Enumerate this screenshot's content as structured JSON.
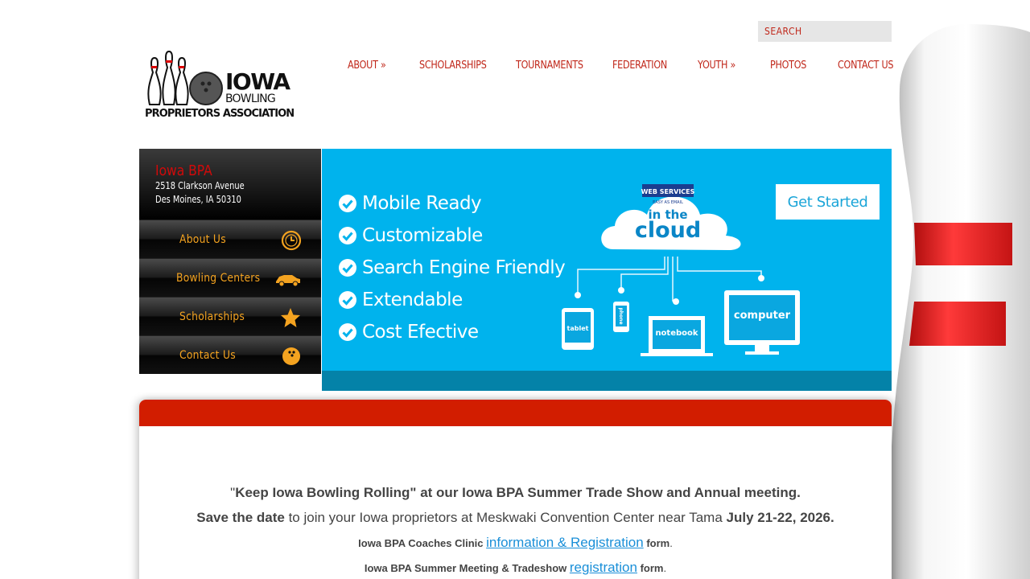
{
  "search": {
    "placeholder": "SEARCH"
  },
  "logo": {
    "line1": "IOWA",
    "line2": "BOWLING",
    "line3": "PROPRIETORS ASSOCIATION"
  },
  "nav": [
    {
      "label": "ABOUT »"
    },
    {
      "label": "SCHOLARSHIPS"
    },
    {
      "label": "TOURNAMENTS"
    },
    {
      "label": "FEDERATION"
    },
    {
      "label": "YOUTH »"
    },
    {
      "label": "PHOTOS"
    },
    {
      "label": "CONTACT US"
    }
  ],
  "sidebar": {
    "org_name": "Iowa BPA",
    "address1": "2518 Clarkson Avenue",
    "address2": "Des Moines, IA 50310",
    "items": [
      {
        "label": "About Us",
        "icon": "clock-icon"
      },
      {
        "label": "Bowling Centers",
        "icon": "car-icon"
      },
      {
        "label": "Scholarships",
        "icon": "star-icon"
      },
      {
        "label": "Contact Us",
        "icon": "bowling-ball-icon"
      }
    ]
  },
  "banner": {
    "features": [
      "Mobile Ready",
      "Customizable",
      "Search Engine Friendly",
      "Extendable",
      "Cost Efective"
    ],
    "cta": "Get Started",
    "cloud_badge": "WEB SERVICES",
    "cloud_badge_sub": "EASY AS EMAIL",
    "cloud_line1": "in the",
    "cloud_line2": "cloud",
    "devices": [
      "tablet",
      "phone",
      "notebook",
      "computer"
    ]
  },
  "content": {
    "l1_quote_open": "\"",
    "l1_bold": "Keep Iowa Bowling Rolling\" at our Iowa BPA Summer Trade Show and Annual meeting.",
    "l2_bold": "Save the date",
    "l2_mid": " to join your Iowa proprietors at Meskwaki Convention Center near Tama ",
    "l2_date": "July 21-22, 2026.",
    "l3_prefix": "Iowa BPA Coaches Clinic ",
    "l3_link": "information & Registration",
    "l3_suffix": " form",
    "l3_dot": ".",
    "l4_prefix": "Iowa BPA Summer Meeting & Tradeshow ",
    "l4_link": "registration",
    "l4_suffix": " form",
    "l4_dot": "."
  },
  "colors": {
    "nav_red": "#c0271a",
    "sidebar_gold": "#f4a320",
    "banner_blue": "#00b3ed",
    "card_red": "#d21d00"
  }
}
